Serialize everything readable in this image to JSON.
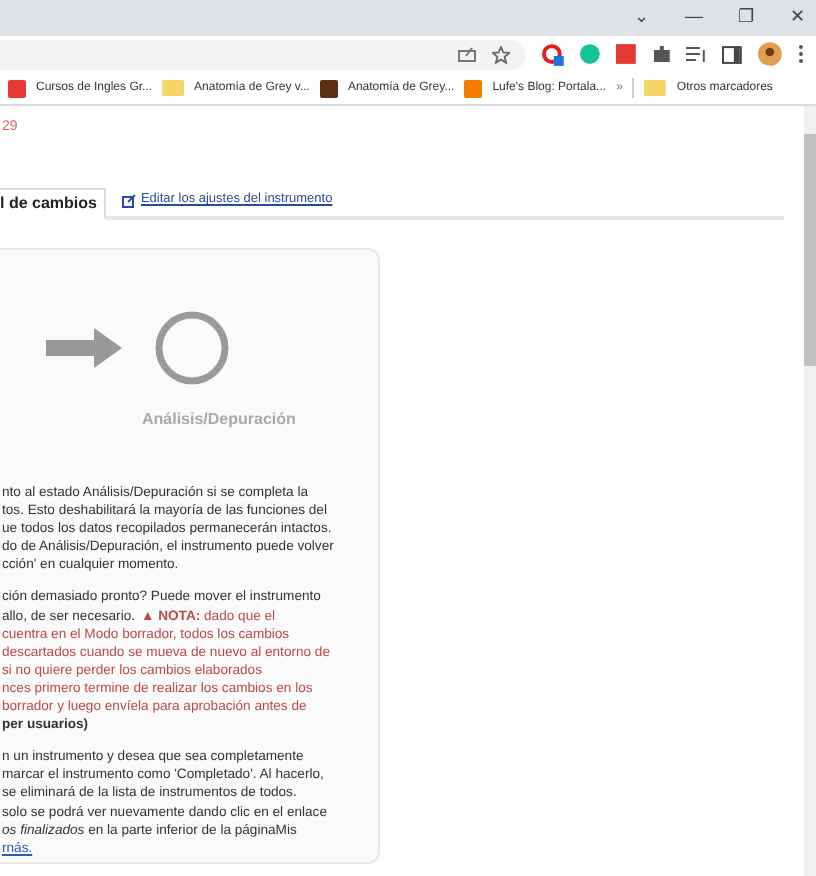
{
  "window_controls": [
    "⌄",
    "—",
    "❐",
    "✕"
  ],
  "bookmarks": [
    {
      "label": "Cursos de Ingles Gr...",
      "color": "#e53935",
      "kind": "square"
    },
    {
      "label": "Anatomía de Grey v...",
      "color": "#f5d66b",
      "kind": "folder"
    },
    {
      "label": "Anatomía de Grey...",
      "color": "#5d2e12",
      "kind": "square"
    },
    {
      "label": "Lufe's Blog: Portala...",
      "color": "#f57c00",
      "kind": "square"
    }
  ],
  "bookmarks_more": "»",
  "other_bookmarks": "Otros marcadores",
  "page_corner_text": "29",
  "tabs": [
    {
      "label": "l de cambios",
      "selected": true,
      "kind": "tab"
    },
    {
      "label": "Editar los ajustes del instrumento",
      "selected": false,
      "kind": "link"
    }
  ],
  "status_label": "Análisis/Depuración",
  "paragraphs": [
    {
      "lines": [
        [
          {
            "text": "nto al estado Análisis/Depuración si se completa la",
            "kind": "normal"
          }
        ],
        [
          {
            "text": "tos. Esto deshabilitará la mayoría de las funciones del",
            "kind": "normal"
          }
        ],
        [
          {
            "text": "ue todos los datos recopilados permanecerán intactos.",
            "kind": "normal"
          }
        ],
        [
          {
            "text": "do de Análisis/Depuración, el instrumento puede volver",
            "kind": "normal"
          }
        ],
        [
          {
            "text": "cción' en cualquier momento.",
            "kind": "normal"
          }
        ]
      ]
    },
    {
      "lines": [
        [
          {
            "text": "ción demasiado pronto? Puede mover el instrumento",
            "kind": "normal"
          }
        ],
        [
          {
            "text": "allo, de ser necesario.",
            "kind": "normal"
          },
          {
            "text": "**▲ NOTA:** dado que el",
            "kind": "warning"
          }
        ],
        [
          {
            "text": "cuentra en el Modo borrador, todos los cambios",
            "kind": "warning"
          }
        ],
        [
          {
            "text": "descartados cuando se mueva de nuevo al entorno de",
            "kind": "warning"
          }
        ],
        [
          {
            "text": "si no quiere perder los cambios elaborados",
            "kind": "warning"
          }
        ],
        [
          {
            "text": "nces primero termine de realizar los cambios en los",
            "kind": "warning"
          }
        ],
        [
          {
            "text": "borrador y luego envíela para aprobación antes de",
            "kind": "warning"
          }
        ],
        [
          {
            "text": "**per usuarios)**",
            "kind": "normal"
          }
        ]
      ]
    },
    {
      "lines": [
        [
          {
            "text": "n un instrumento y desea que sea completamente",
            "kind": "normal"
          }
        ],
        [
          {
            "text": "marcar el instrumento como 'Completado'. Al hacerlo,",
            "kind": "normal"
          }
        ],
        [
          {
            "text": "se eliminará de la lista de instrumentos de todos.",
            "kind": "normal"
          }
        ],
        [
          {
            "text": "solo se podrá ver nuevamente dando clic en el enlace",
            "kind": "normal"
          }
        ],
        [
          {
            "text": "*os finalizados* en la parte inferior de la páginaMis",
            "kind": "normal"
          }
        ],
        [
          {
            "text": "rnás.",
            "kind": "link"
          }
        ]
      ]
    }
  ]
}
